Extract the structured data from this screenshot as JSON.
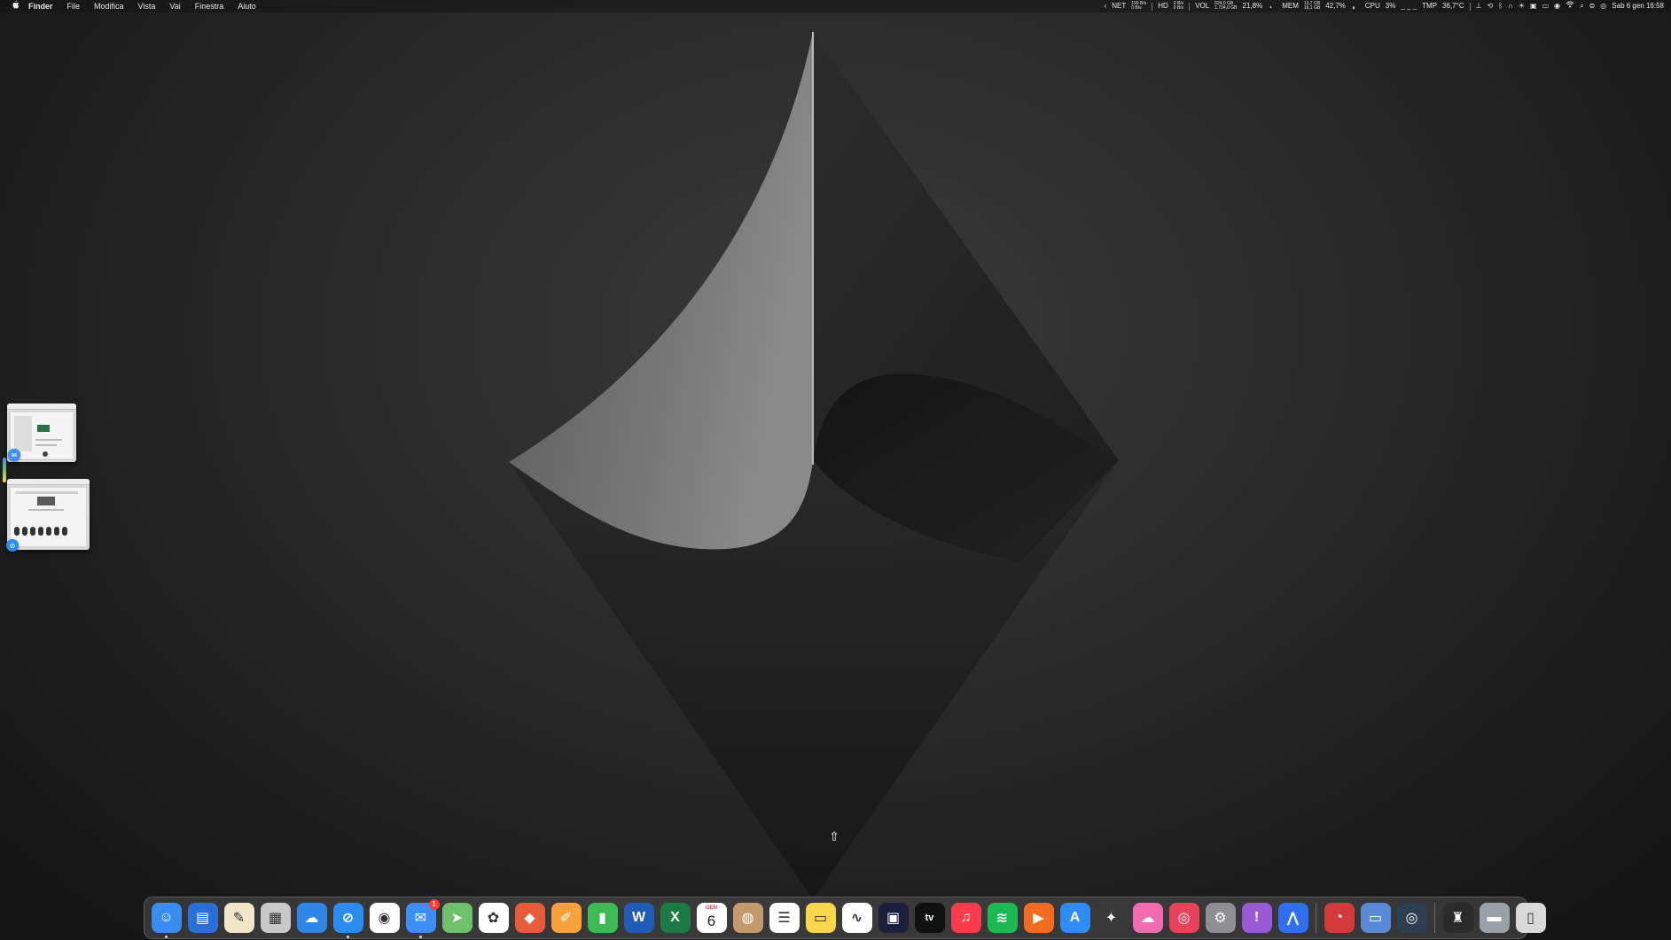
{
  "menubar": {
    "app_name": "Finder",
    "menus": [
      "File",
      "Modifica",
      "Vista",
      "Vai",
      "Finestra",
      "Aiuto"
    ],
    "status": {
      "net_label": "NET",
      "net_up": "190 B/s",
      "net_down": "0 B/s",
      "hd_label": "HD",
      "hd_read": "0 B/s",
      "hd_write": "0 B/s",
      "vol_label": "VOL",
      "vol_used": "524,0 GB",
      "vol_total": "1.734,0 GB",
      "mem_percent": "21,8%",
      "mem_label": "MEM",
      "mem_used": "13,7 GB",
      "mem_total": "16,1 GB",
      "cpu_percent": "42,7%",
      "cpu_label": "CPU",
      "cpu_load": "3%",
      "tmp_label": "TMP",
      "tmp_value": "36,7°C",
      "datetime": "Sab 6 gen  16:58"
    }
  },
  "dock": {
    "apps": [
      {
        "name": "finder",
        "color": "#3a8df0",
        "glyph": "☺",
        "running": true
      },
      {
        "name": "files",
        "color": "#2a6fd6",
        "glyph": "▤",
        "running": false
      },
      {
        "name": "notes-pen",
        "color": "#f2e6c8",
        "glyph": "✎",
        "running": false
      },
      {
        "name": "launchpad",
        "color": "#c8c8c8",
        "glyph": "▦",
        "running": false
      },
      {
        "name": "weather",
        "color": "#2f86e6",
        "glyph": "☁",
        "running": false
      },
      {
        "name": "safari",
        "color": "#2b8cf0",
        "glyph": "⊘",
        "running": true
      },
      {
        "name": "chrome",
        "color": "#ffffff",
        "glyph": "◉",
        "running": false
      },
      {
        "name": "mail",
        "color": "#3d8ff5",
        "glyph": "✉",
        "running": true,
        "badge": "1"
      },
      {
        "name": "maps",
        "color": "#6fc26b",
        "glyph": "➤",
        "running": false
      },
      {
        "name": "photos",
        "color": "#ffffff",
        "glyph": "✿",
        "running": false
      },
      {
        "name": "pixelmator",
        "color": "#e85b3a",
        "glyph": "◆",
        "running": false
      },
      {
        "name": "pages",
        "color": "#f7a23a",
        "glyph": "✐",
        "running": false
      },
      {
        "name": "numbers",
        "color": "#3cba54",
        "glyph": "▮",
        "running": false
      },
      {
        "name": "word",
        "color": "#1e5cb8",
        "glyph": "W",
        "running": false
      },
      {
        "name": "excel",
        "color": "#1d7a44",
        "glyph": "X",
        "running": false
      },
      {
        "name": "calendar",
        "color": "#ffffff",
        "glyph": "",
        "running": false,
        "calendar_month": "GEN",
        "calendar_day": "6"
      },
      {
        "name": "contacts",
        "color": "#c49a6c",
        "glyph": "◍",
        "running": false
      },
      {
        "name": "reminders",
        "color": "#ffffff",
        "glyph": "☰",
        "running": false
      },
      {
        "name": "notes",
        "color": "#f7d64a",
        "glyph": "▭",
        "running": false
      },
      {
        "name": "freeform",
        "color": "#ffffff",
        "glyph": "∿",
        "running": false
      },
      {
        "name": "zoom",
        "color": "#1a1f3c",
        "glyph": "▣",
        "running": false
      },
      {
        "name": "apple-tv",
        "color": "#111111",
        "glyph": "tv",
        "running": false
      },
      {
        "name": "music",
        "color": "#fa3c4c",
        "glyph": "♫",
        "running": false
      },
      {
        "name": "spotify",
        "color": "#1db954",
        "glyph": "≋",
        "running": false
      },
      {
        "name": "infuse",
        "color": "#f36b21",
        "glyph": "▶",
        "running": false
      },
      {
        "name": "app-store",
        "color": "#2f8cf4",
        "glyph": "A",
        "running": false
      },
      {
        "name": "craft",
        "color": "#3a3a3a",
        "glyph": "✦",
        "running": false
      },
      {
        "name": "cloud-app",
        "color": "#f06bb0",
        "glyph": "☁",
        "running": false
      },
      {
        "name": "camera-app",
        "color": "#e8435a",
        "glyph": "◎",
        "running": false
      },
      {
        "name": "system-settings",
        "color": "#8e8e93",
        "glyph": "⚙",
        "running": false
      },
      {
        "name": "feedback",
        "color": "#9b59d6",
        "glyph": "!",
        "running": false
      },
      {
        "name": "nordvpn",
        "color": "#2f6ff0",
        "glyph": "⋀",
        "running": false
      }
    ],
    "utilities": [
      {
        "name": "speed-test",
        "color": "#d33b3b",
        "glyph": "◔",
        "running": false
      },
      {
        "name": "screen-sharing",
        "color": "#5a8ad6",
        "glyph": "▭",
        "running": false
      },
      {
        "name": "network-radar",
        "color": "#2c3e50",
        "glyph": "◎",
        "running": false
      }
    ],
    "trailing": [
      {
        "name": "bartender",
        "color": "#2b2b2b",
        "glyph": "♜",
        "running": false
      },
      {
        "name": "downloads-folder",
        "color": "#9aa0a6",
        "glyph": "▬",
        "running": false
      },
      {
        "name": "trash",
        "color": "#d9d9d9",
        "glyph": "▯",
        "running": false
      }
    ]
  },
  "stage_manager": {
    "windows": [
      {
        "name": "finder-window",
        "badge_color": "#3a8df0"
      },
      {
        "name": "safari-window",
        "badge_color": "#2b8cf0"
      }
    ]
  }
}
